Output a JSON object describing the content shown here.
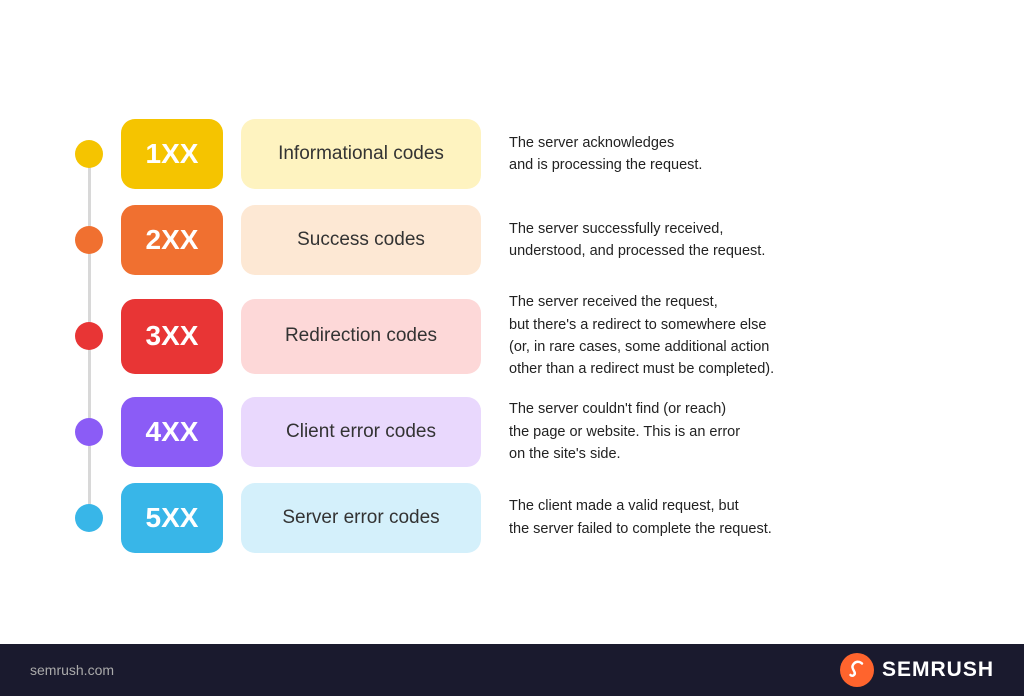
{
  "rows": [
    {
      "id": "1xx",
      "code": "1XX",
      "label": "Informational codes",
      "description": "The server acknowledges\nand is processing the request.",
      "dotColor": "#f5c400",
      "codeColor": "#f5c400",
      "labelBg": "#fef3c0",
      "class": "row-1"
    },
    {
      "id": "2xx",
      "code": "2XX",
      "label": "Success codes",
      "description": "The server successfully received,\nunderstood, and processed the request.",
      "dotColor": "#f07030",
      "codeColor": "#f07030",
      "labelBg": "#fde8d4",
      "class": "row-2"
    },
    {
      "id": "3xx",
      "code": "3XX",
      "label": "Redirection codes",
      "description": "The server received the request,\nbut there's a redirect to somewhere else\n(or, in rare cases, some additional action\nother than a redirect must be completed).",
      "dotColor": "#e83535",
      "codeColor": "#e83535",
      "labelBg": "#fdd8d8",
      "class": "row-3"
    },
    {
      "id": "4xx",
      "code": "4XX",
      "label": "Client error codes",
      "description": "The server couldn't find (or reach)\nthe page or website. This is an error\non the site's side.",
      "dotColor": "#8b5cf6",
      "codeColor": "#8b5cf6",
      "labelBg": "#e9d8fd",
      "class": "row-4"
    },
    {
      "id": "5xx",
      "code": "5XX",
      "label": "Server error codes",
      "description": "The client made a valid request, but\nthe server failed to complete the request.",
      "dotColor": "#38b6e8",
      "codeColor": "#38b6e8",
      "labelBg": "#d4f0fb",
      "class": "row-5"
    }
  ],
  "footer": {
    "url": "semrush.com",
    "brand": "SEMRUSH"
  }
}
